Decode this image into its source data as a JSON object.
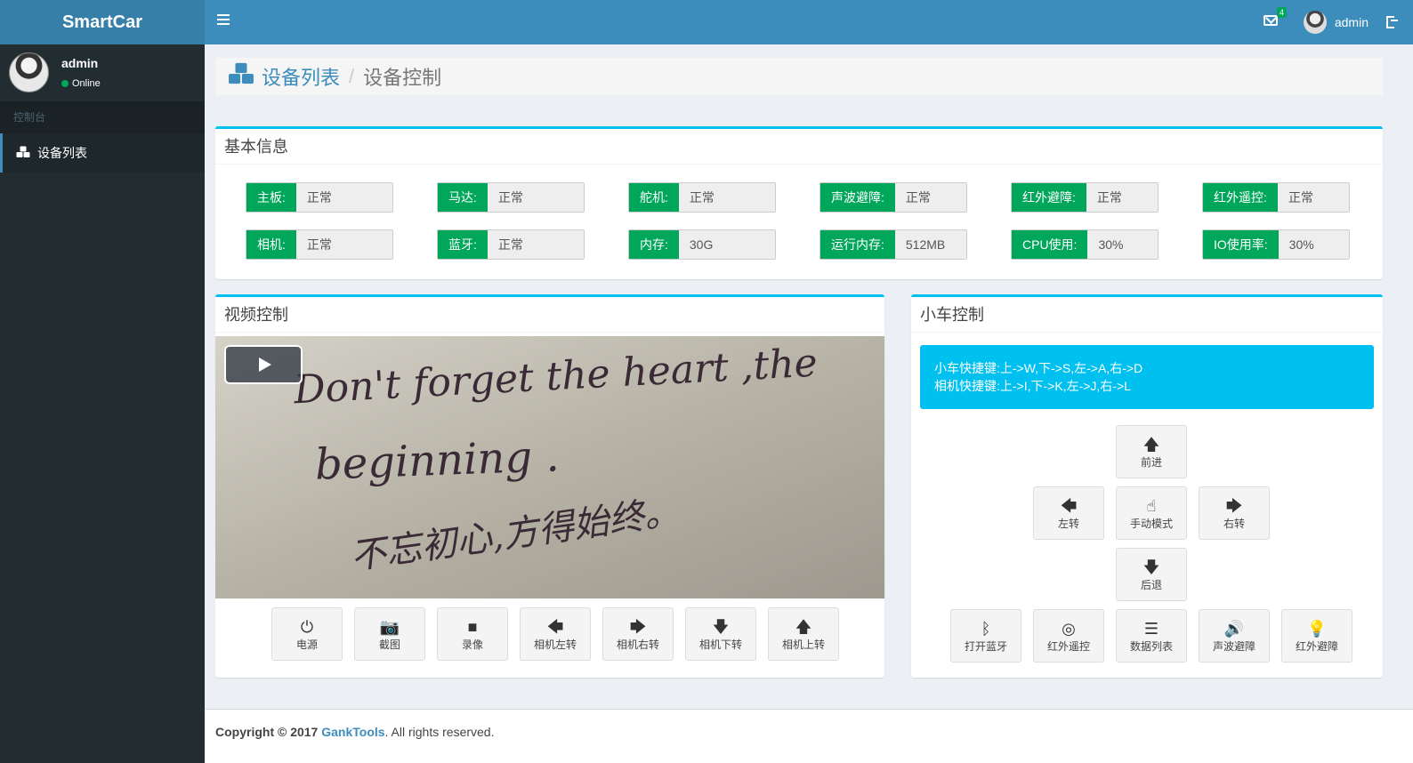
{
  "app": {
    "logo": "SmartCar"
  },
  "topbar": {
    "mail_count": "4",
    "user": "admin"
  },
  "sidebar": {
    "user_name": "admin",
    "status": "Online",
    "header": "控制台",
    "items": [
      {
        "label": "设备列表",
        "icon": "cubes-icon"
      }
    ]
  },
  "breadcrumb": {
    "parent": "设备列表",
    "current": "设备控制"
  },
  "basic_info": {
    "title": "基本信息",
    "items": [
      {
        "label": "主板:",
        "value": "正常"
      },
      {
        "label": "马达:",
        "value": "正常"
      },
      {
        "label": "舵机:",
        "value": "正常"
      },
      {
        "label": "声波避障:",
        "value": "正常"
      },
      {
        "label": "红外避障:",
        "value": "正常"
      },
      {
        "label": "红外遥控:",
        "value": "正常"
      },
      {
        "label": "相机:",
        "value": "正常"
      },
      {
        "label": "蓝牙:",
        "value": "正常"
      },
      {
        "label": "内存:",
        "value": "30G"
      },
      {
        "label": "运行内存:",
        "value": "512MB"
      },
      {
        "label": "CPU使用:",
        "value": "30%"
      },
      {
        "label": "IO使用率:",
        "value": "30%"
      }
    ]
  },
  "video": {
    "title": "视频控制",
    "frame_text": {
      "line1": "Don't forget the heart ,the",
      "line2": "beginning .",
      "line3": "不忘初心,方得始终。"
    },
    "buttons": [
      {
        "label": "电源",
        "icon": "power-icon"
      },
      {
        "label": "截图",
        "icon": "camera-icon"
      },
      {
        "label": "录像",
        "icon": "video-camera-icon"
      },
      {
        "label": "相机左转",
        "icon": "arrow-left-icon"
      },
      {
        "label": "相机右转",
        "icon": "arrow-right-icon"
      },
      {
        "label": "相机下转",
        "icon": "arrow-down-icon"
      },
      {
        "label": "相机上转",
        "icon": "arrow-up-icon"
      }
    ]
  },
  "car": {
    "title": "小车控制",
    "shortcut_car": "小车快捷键:上->W,下->S,左->A,右->D",
    "shortcut_camera": "相机快捷键:上->I,下->K,左->J,右->L",
    "dpad": {
      "forward": "前进",
      "left": "左转",
      "manual": "手动模式",
      "right": "右转",
      "back": "后退"
    },
    "buttons": [
      {
        "label": "打开蓝牙",
        "icon": "bluetooth-icon"
      },
      {
        "label": "红外遥控",
        "icon": "target-icon"
      },
      {
        "label": "数据列表",
        "icon": "list-icon"
      },
      {
        "label": "声波避障",
        "icon": "volume-icon"
      },
      {
        "label": "红外避障",
        "icon": "lightbulb-icon"
      }
    ]
  },
  "footer": {
    "prefix": "Copyright © 2017 ",
    "brand": "GankTools",
    "suffix": ". All rights reserved."
  }
}
